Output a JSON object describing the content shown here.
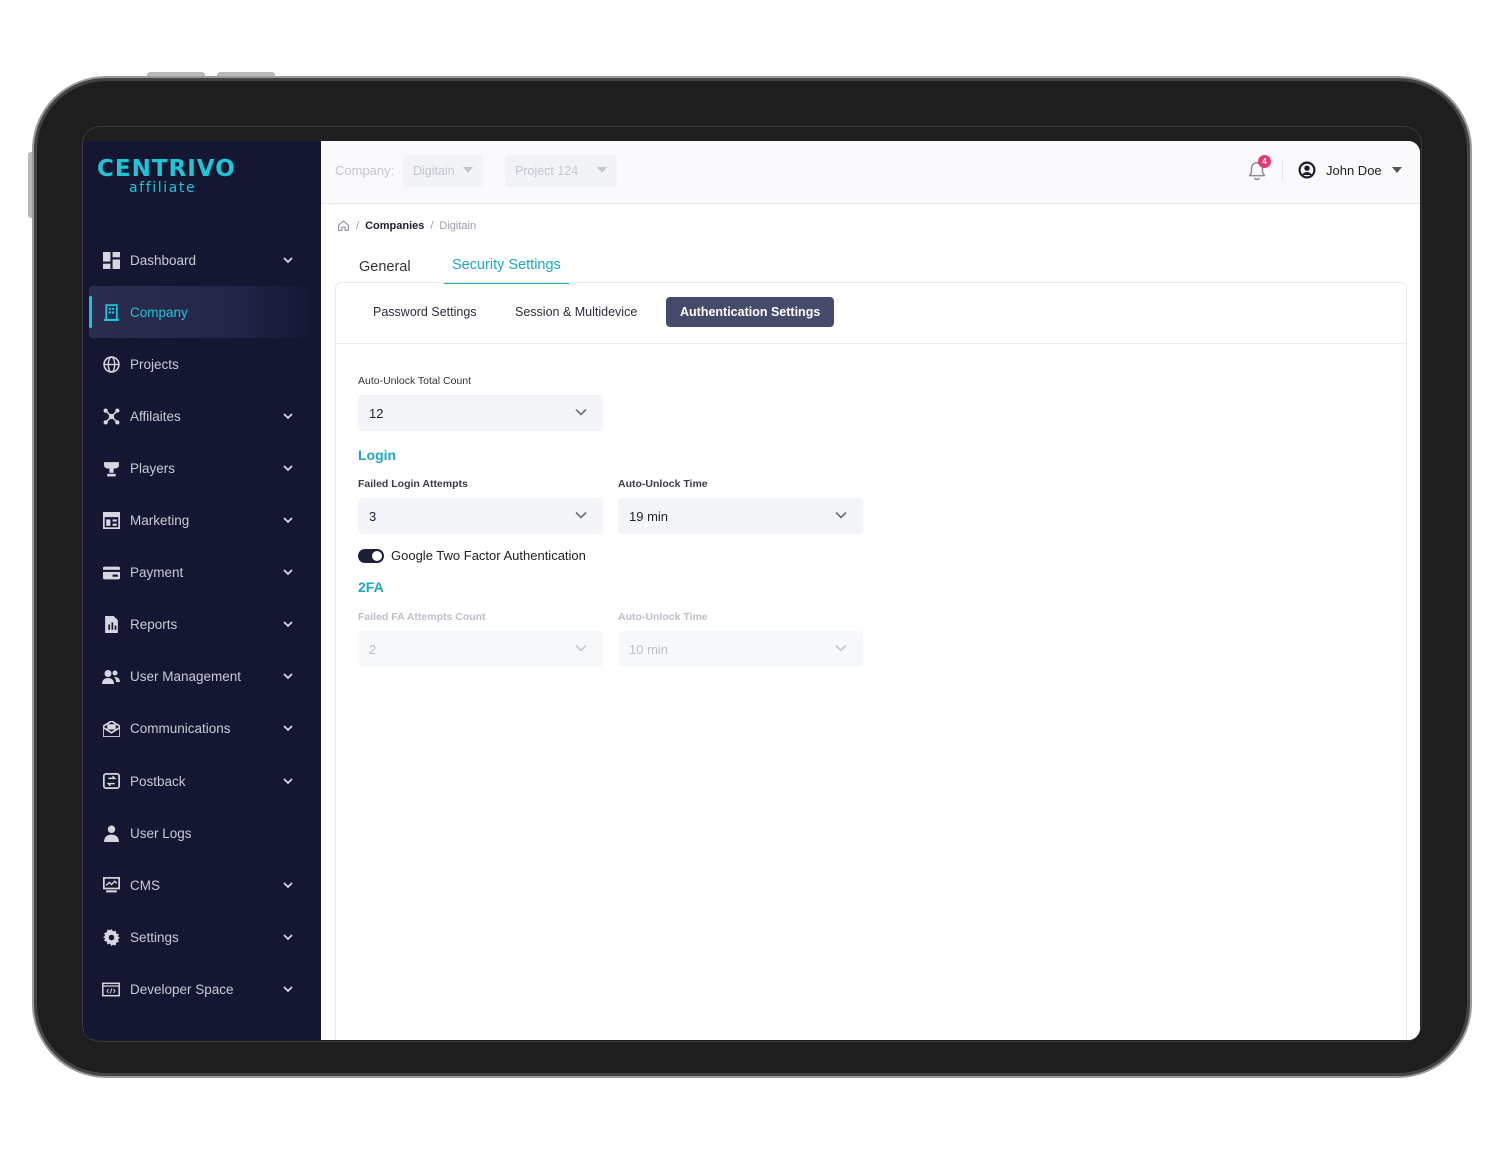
{
  "brand": {
    "name": "CENTRIVO",
    "sub": "affiliate"
  },
  "sidebar": {
    "items": [
      {
        "label": "Dashboard",
        "icon": "dashboard-icon",
        "chevron": true
      },
      {
        "label": "Company",
        "icon": "building-icon",
        "chevron": false,
        "active": true
      },
      {
        "label": "Projects",
        "icon": "globe-icon",
        "chevron": false
      },
      {
        "label": "Affilaites",
        "icon": "network-icon",
        "chevron": true
      },
      {
        "label": "Players",
        "icon": "trophy-icon",
        "chevron": true
      },
      {
        "label": "Marketing",
        "icon": "layout-icon",
        "chevron": true
      },
      {
        "label": "Payment",
        "icon": "card-icon",
        "chevron": true
      },
      {
        "label": "Reports",
        "icon": "report-icon",
        "chevron": true
      },
      {
        "label": "User Management",
        "icon": "users-icon",
        "chevron": true
      },
      {
        "label": "Communications",
        "icon": "mail-icon",
        "chevron": true
      },
      {
        "label": "Postback",
        "icon": "postback-icon",
        "chevron": true
      },
      {
        "label": "User Logs",
        "icon": "user-log-icon",
        "chevron": false
      },
      {
        "label": "CMS",
        "icon": "cms-icon",
        "chevron": true
      },
      {
        "label": "Settings",
        "icon": "gear-icon",
        "chevron": true
      },
      {
        "label": "Developer Space",
        "icon": "code-icon",
        "chevron": true
      }
    ]
  },
  "topbar": {
    "company_label": "Company:",
    "company_value": "Digitain",
    "project_value": "Project 124",
    "notifications": "4",
    "user_name": "John Doe"
  },
  "breadcrumb": {
    "level1": "Companies",
    "level2": "Digitain"
  },
  "tabs": {
    "general": "General",
    "security": "Security Settings"
  },
  "subtabs": {
    "password": "Password Settings",
    "session": "Session & Multidevice",
    "auth": "Authentication Settings"
  },
  "form": {
    "total_count_label": "Auto-Unlock Total Count",
    "total_count_value": "12",
    "login_title": "Login",
    "failed_login_label": "Failed Login Attempts",
    "failed_login_value": "3",
    "auto_unlock_label": "Auto-Unlock Time",
    "auto_unlock_value": "19 min",
    "google_2fa_label": "Google Two Factor Authentication",
    "google_2fa_on": true,
    "twofa_title": "2FA",
    "failed_fa_label": "Failed FA Attempts Count",
    "failed_fa_value": "2",
    "fa_unlock_label": "Auto-Unlock Time",
    "fa_unlock_value": "10 min"
  },
  "colors": {
    "accent": "#1aa9c0",
    "sidebar": "#141632",
    "active_subtab": "#464a6b",
    "badge": "#e53b73"
  }
}
